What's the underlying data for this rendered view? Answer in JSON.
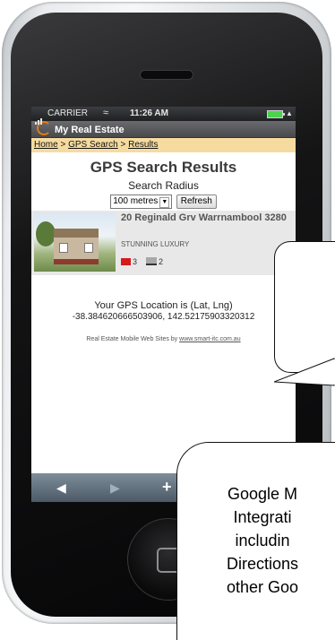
{
  "status_bar": {
    "carrier": "CARRIER",
    "time": "11:26 AM"
  },
  "app": {
    "title": "My Real Estate"
  },
  "breadcrumb": {
    "home": "Home",
    "sep1": " > ",
    "gps_search": "GPS Search",
    "sep2": " > ",
    "results": "Results"
  },
  "page": {
    "title": "GPS Search Results",
    "radius_label": "Search Radius",
    "radius_value": "100 metres",
    "refresh_label": "Refresh"
  },
  "listings": [
    {
      "address": "20 Reginald Grv Warrnambool 3280",
      "tagline": "STUNNING LUXURY",
      "beds": "3",
      "baths": "2"
    }
  ],
  "gps": {
    "label": "Your GPS Location is (Lat, Lng)",
    "coords": "-38.384620666503906, 142.52175903320312"
  },
  "footer": {
    "credit_text": "Real Estate Mobile Web Sites by ",
    "credit_link": "www.smart-itc.com.au"
  },
  "toolbar": {
    "back_icon": "back-arrow-icon",
    "forward_icon": "forward-arrow-icon",
    "add_icon": "plus-icon"
  },
  "callout": {
    "line1": "Google M",
    "line2": "Integrati",
    "line3": "includin",
    "line4": "Directions",
    "line5": "other Goo"
  }
}
